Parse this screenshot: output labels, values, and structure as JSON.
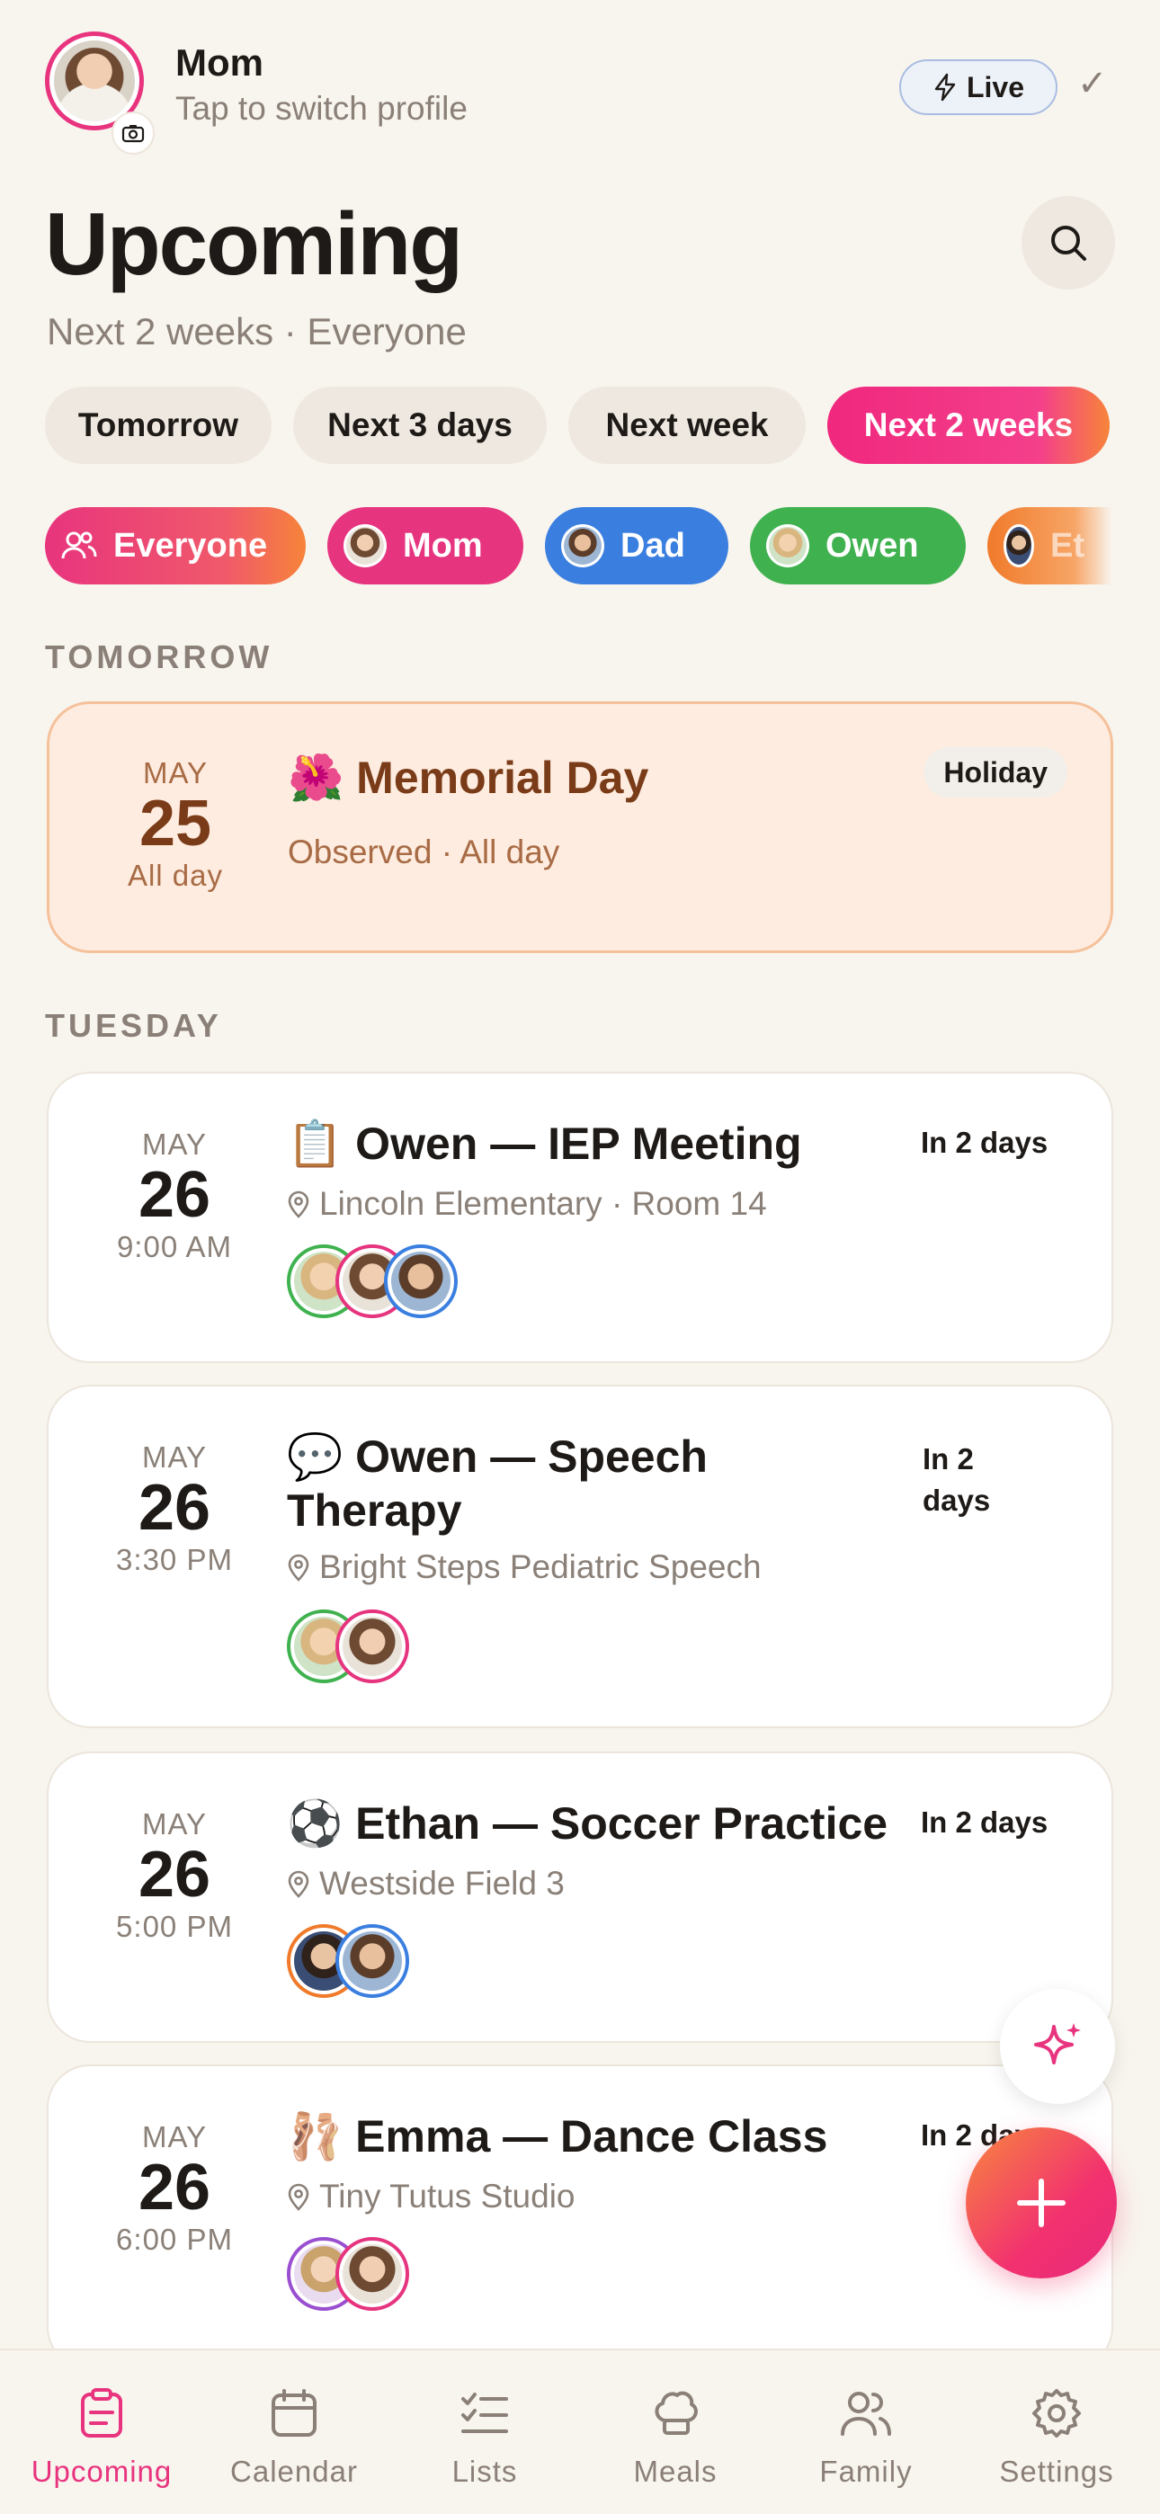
{
  "header": {
    "profile_name": "Mom",
    "profile_hint": "Tap to switch profile",
    "live_label": "Live",
    "title": "Upcoming",
    "subtitle": "Next 2 weeks · Everyone"
  },
  "range_chips": [
    "Tomorrow",
    "Next 3 days",
    "Next week",
    "Next 2 weeks"
  ],
  "range_selected": "Next 2 weeks",
  "people_chips": [
    {
      "label": "Everyone",
      "color": "#e8347e"
    },
    {
      "label": "Mom",
      "color": "#e6347f"
    },
    {
      "label": "Dad",
      "color": "#3a7fe0"
    },
    {
      "label": "Owen",
      "color": "#3fb24f"
    },
    {
      "label": "Et",
      "color": "#f07a2a"
    }
  ],
  "sections": {
    "tomorrow": "TOMORROW",
    "tuesday": "TUESDAY"
  },
  "holiday": {
    "month": "MAY",
    "day": "25",
    "time": "All day",
    "emoji": "🌺",
    "title": "Memorial Day",
    "detail": "Observed · All day",
    "tag": "Holiday"
  },
  "events": [
    {
      "month": "MAY",
      "day": "26",
      "time": "9:00 AM",
      "emoji": "📋",
      "title": "Owen — IEP Meeting",
      "location": "Lincoln Elementary · Room 14",
      "when": "In 2 days",
      "attendees": [
        "Owen",
        "Mom",
        "Dad"
      ]
    },
    {
      "month": "MAY",
      "day": "26",
      "time": "3:30 PM",
      "emoji": "💬",
      "title": "Owen — Speech Therapy",
      "location": "Bright Steps Pediatric Speech",
      "when": "In 2 days",
      "attendees": [
        "Owen",
        "Mom"
      ]
    },
    {
      "month": "MAY",
      "day": "26",
      "time": "5:00 PM",
      "emoji": "⚽",
      "title": "Ethan — Soccer Practice",
      "location": "Westside Field 3",
      "when": "In 2 days",
      "attendees": [
        "Ethan",
        "Dad"
      ]
    },
    {
      "month": "MAY",
      "day": "26",
      "time": "6:00 PM",
      "emoji": "🩰",
      "title": "Emma — Dance Class",
      "location": "Tiny Tutus Studio",
      "when": "In 2 days",
      "attendees": [
        "Emma",
        "Mom"
      ]
    }
  ],
  "tabs": [
    "Upcoming",
    "Calendar",
    "Lists",
    "Meals",
    "Family",
    "Settings"
  ],
  "colors": {
    "accent": "#e8347e",
    "owen": "#3fb24f",
    "mom": "#e6347f",
    "dad": "#3a7fe0",
    "ethan": "#f07a2a",
    "emma": "#9a4fd0"
  }
}
